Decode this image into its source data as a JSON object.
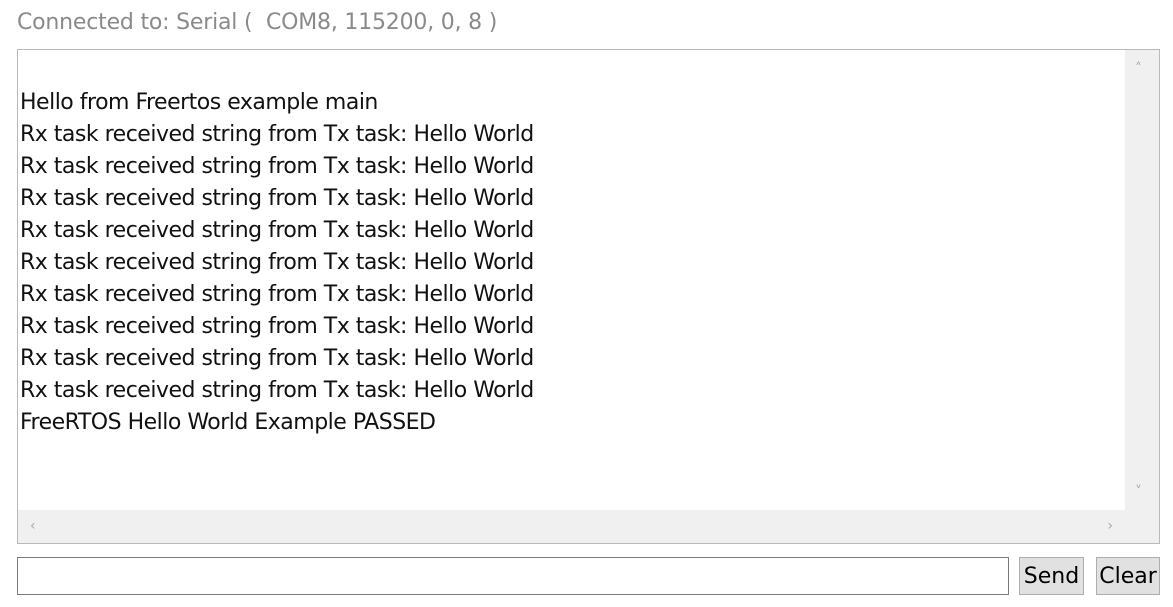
{
  "connection": {
    "status_text": "Connected to: Serial (  COM8, 115200, 0, 8 )"
  },
  "terminal": {
    "lines": [
      "",
      "Hello from Freertos example main",
      "Rx task received string from Tx task: Hello World",
      "Rx task received string from Tx task: Hello World",
      "Rx task received string from Tx task: Hello World",
      "Rx task received string from Tx task: Hello World",
      "Rx task received string from Tx task: Hello World",
      "Rx task received string from Tx task: Hello World",
      "Rx task received string from Tx task: Hello World",
      "Rx task received string from Tx task: Hello World",
      "Rx task received string from Tx task: Hello World",
      "FreeRTOS Hello World Example PASSED"
    ],
    "scroll_icons": {
      "up": "chevron-up-icon",
      "down": "chevron-down-icon",
      "left": "chevron-left-icon",
      "right": "chevron-right-icon"
    }
  },
  "input": {
    "value": "",
    "placeholder": ""
  },
  "buttons": {
    "send_label": "Send",
    "clear_label": "Clear"
  },
  "colors": {
    "status_text": "#8a8a8a",
    "button_bg": "#e1e1e1",
    "scrollbar_bg": "#f0f0f0"
  }
}
